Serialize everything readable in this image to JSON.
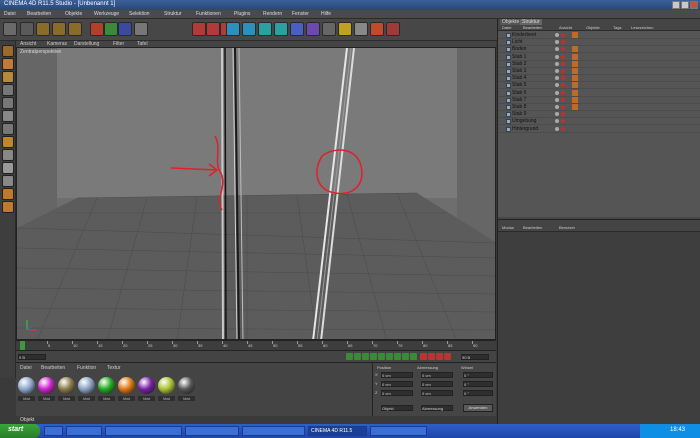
{
  "window": {
    "title": "CINEMA 4D R11.5 Studio - [Unbenannt 1]"
  },
  "menubar": {
    "items": [
      "Datei",
      "Bearbeiten",
      "Objekte",
      "Werkzeuge",
      "Selektion",
      "Struktur",
      "Funktionen",
      "Plugins",
      "Rendern",
      "Fenster",
      "Hilfe"
    ]
  },
  "toolbar": {
    "buttons": [
      "undo-icon",
      "pointer-icon",
      "move-icon",
      "scale-icon",
      "rotate-icon",
      "axis-x-icon",
      "axis-y-icon",
      "axis-z-icon",
      "coords-icon",
      "render-view-icon",
      "render-pic-icon",
      "render-settings-icon",
      "cube-icon",
      "pen-icon",
      "subdivision-icon",
      "array-icon",
      "deformer-icon",
      "scene-icon",
      "camera-icon",
      "light-icon",
      "magnet-icon",
      "scripts-icon",
      "layout-icon"
    ]
  },
  "left_tools": [
    "model-icon",
    "texture-icon",
    "axis-icon",
    "points-icon",
    "edges-icon",
    "polygons-icon",
    "uv-icon",
    "tweak-icon",
    "lock-icon",
    "grid-icon",
    "snap-icon",
    "paint-icon",
    "sculpt-icon"
  ],
  "viewport": {
    "menu": [
      "Ansicht",
      "Kameras",
      "Darstellung",
      "Filter",
      "Tafel"
    ],
    "label": "Zentralperspektive"
  },
  "timeline": {
    "ticks": [
      "0",
      "5",
      "10",
      "15",
      "20",
      "25",
      "30",
      "35",
      "40",
      "45",
      "50",
      "55",
      "60",
      "65",
      "70",
      "75",
      "80",
      "85",
      "90"
    ],
    "current_frame": "0 B"
  },
  "transport": {
    "start": "0 B",
    "end": "90 B"
  },
  "materials": {
    "menu": [
      "Datei",
      "Bearbeiten",
      "Funktion",
      "Textur"
    ],
    "items": [
      {
        "label": "Mat",
        "color": "#8da6c9"
      },
      {
        "label": "Mat",
        "color": "#cc22cc"
      },
      {
        "label": "Mat",
        "color": "#8a7a4a"
      },
      {
        "label": "Mat",
        "color": "#8aa0c0"
      },
      {
        "label": "Mat",
        "color": "#22aa22"
      },
      {
        "label": "Mat",
        "color": "#dd7711"
      },
      {
        "label": "Mat",
        "color": "#7a1fa8"
      },
      {
        "label": "Mat",
        "color": "#a8c030"
      },
      {
        "label": "Mat",
        "color": "#555555"
      }
    ]
  },
  "coords": {
    "headers": [
      "Position",
      "Abmessung",
      "Winkel"
    ],
    "rows": [
      {
        "axis": "X",
        "pos": "0 cm",
        "size": "0 cm",
        "rot": "0 °"
      },
      {
        "axis": "Y",
        "pos": "0 cm",
        "size": "0 cm",
        "rot": "0 °"
      },
      {
        "axis": "Z",
        "pos": "0 cm",
        "size": "0 cm",
        "rot": "0 °"
      }
    ],
    "mode": "Objekt",
    "mode2": "Abmessung",
    "apply": "Anwenden"
  },
  "statusbar": {
    "text": "Objekt"
  },
  "object_manager": {
    "tabs": [
      "Objekte",
      "Struktur"
    ],
    "menu": [
      "Datei",
      "Bearbeiten",
      "Ansicht",
      "Objekte",
      "Tags",
      "Lesezeichen"
    ],
    "rows": [
      "Kinderbeet",
      "Licht",
      "Boden",
      "Stab 1",
      "Stab 2",
      "Stab 3",
      "Stab 4",
      "Stab 5",
      "Stab 6",
      "Stab 7",
      "Stab 8",
      "Stab 9",
      "Umgebung",
      "Hintergrund"
    ]
  },
  "attribute_manager": {
    "menu": [
      "Modus",
      "Bearbeiten",
      "Benutzer"
    ]
  },
  "taskbar": {
    "start": "start",
    "tasks": [
      "",
      "",
      "",
      "",
      "",
      "CINEMA 4D R11.5",
      ""
    ],
    "clock": "18:43"
  },
  "colors": {
    "annotation": "#e0202a",
    "floor": "#5c5c5c",
    "wall": "#7a7a7a"
  }
}
